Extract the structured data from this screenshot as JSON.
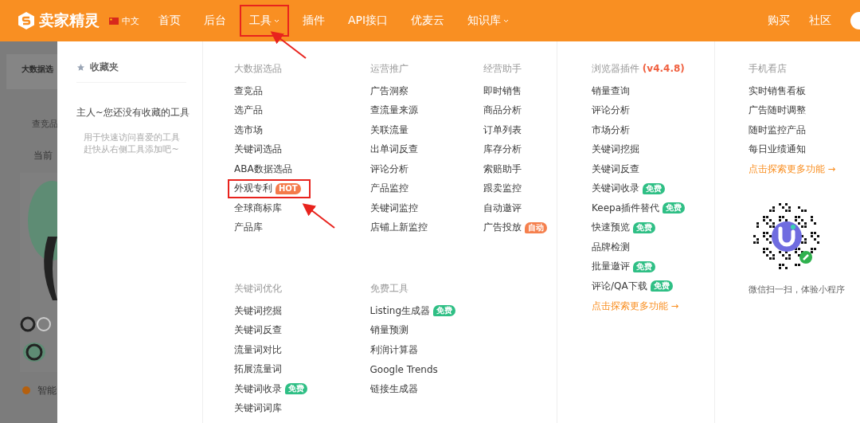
{
  "header": {
    "logo": "卖家精灵",
    "language": "中文",
    "nav": [
      {
        "label": "首页",
        "dropdown": false
      },
      {
        "label": "后台",
        "dropdown": false
      },
      {
        "label": "工具",
        "dropdown": true,
        "annotated": true
      },
      {
        "label": "插件",
        "dropdown": false
      },
      {
        "label": "API接口",
        "dropdown": false
      },
      {
        "label": "优麦云",
        "dropdown": false
      },
      {
        "label": "知识库",
        "dropdown": true
      }
    ],
    "right": [
      "购买",
      "社区"
    ]
  },
  "background_page": {
    "title": "大数据选",
    "tab": "查竞品",
    "note": "当前",
    "bottom": "智能"
  },
  "favorites": {
    "title": "收藏夹",
    "empty_title": "主人~您还没有收藏的工具",
    "empty_hint": [
      "用于快速访问喜爱的工具",
      "赶快从右侧工具添加吧~"
    ]
  },
  "groups": [
    {
      "columns": [
        {
          "sections": [
            {
              "title": "大数据选品",
              "items": [
                {
                  "label": "查竞品"
                },
                {
                  "label": "选产品"
                },
                {
                  "label": "选市场"
                },
                {
                  "label": "关键词选品"
                },
                {
                  "label": "ABA数据选品"
                },
                {
                  "label": "外观专利",
                  "badge": {
                    "kind": "hot",
                    "text": "HOT"
                  },
                  "annotated": true
                },
                {
                  "label": "全球商标库"
                },
                {
                  "label": "产品库"
                }
              ]
            },
            {
              "title": "关键词优化",
              "items": [
                {
                  "label": "关键词挖掘"
                },
                {
                  "label": "关键词反查"
                },
                {
                  "label": "流量词对比"
                },
                {
                  "label": "拓展流量词"
                },
                {
                  "label": "关键词收录",
                  "badge": {
                    "kind": "free",
                    "text": "免费"
                  }
                },
                {
                  "label": "关键词词库"
                }
              ]
            }
          ]
        },
        {
          "sections": [
            {
              "title": "运营推广",
              "items": [
                {
                  "label": "广告洞察"
                },
                {
                  "label": "查流量来源"
                },
                {
                  "label": "关联流量"
                },
                {
                  "label": "出单词反查"
                },
                {
                  "label": "评论分析"
                },
                {
                  "label": "产品监控"
                },
                {
                  "label": "关键词监控"
                },
                {
                  "label": "店铺上新监控"
                }
              ]
            },
            {
              "title": "免费工具",
              "items": [
                {
                  "label": "Listing生成器",
                  "badge": {
                    "kind": "free",
                    "text": "免费"
                  }
                },
                {
                  "label": "销量预测"
                },
                {
                  "label": "利润计算器"
                },
                {
                  "label": "Google Trends"
                },
                {
                  "label": "链接生成器"
                }
              ]
            }
          ]
        },
        {
          "sections": [
            {
              "title": "经营助手",
              "items": [
                {
                  "label": "即时销售"
                },
                {
                  "label": "商品分析"
                },
                {
                  "label": "订单列表"
                },
                {
                  "label": "库存分析"
                },
                {
                  "label": "索赔助手"
                },
                {
                  "label": "跟卖监控"
                },
                {
                  "label": "自动邀评"
                },
                {
                  "label": "广告投放",
                  "badge": {
                    "kind": "auto",
                    "text": "自动"
                  }
                }
              ]
            }
          ]
        }
      ]
    },
    {
      "columns": [
        {
          "sections": [
            {
              "title": "浏览器插件",
              "version": "(v4.4.8)",
              "items": [
                {
                  "label": "销量查询"
                },
                {
                  "label": "评论分析"
                },
                {
                  "label": "市场分析"
                },
                {
                  "label": "关键词挖掘"
                },
                {
                  "label": "关键词反查"
                },
                {
                  "label": "关键词收录",
                  "badge": {
                    "kind": "free",
                    "text": "免费"
                  }
                },
                {
                  "label": "Keepa插件替代",
                  "badge": {
                    "kind": "free",
                    "text": "免费"
                  }
                },
                {
                  "label": "快速预览",
                  "badge": {
                    "kind": "free",
                    "text": "免费"
                  }
                },
                {
                  "label": "品牌检测"
                },
                {
                  "label": "批量邀评",
                  "badge": {
                    "kind": "free",
                    "text": "免费"
                  }
                },
                {
                  "label": "评论/QA下载",
                  "badge": {
                    "kind": "free",
                    "text": "免费"
                  }
                }
              ],
              "more": "点击探索更多功能 →"
            }
          ]
        }
      ]
    },
    {
      "columns": [
        {
          "sections": [
            {
              "title": "手机看店",
              "items": [
                {
                  "label": "实时销售看板"
                },
                {
                  "label": "广告随时调整"
                },
                {
                  "label": "随时监控产品"
                },
                {
                  "label": "每日业绩通知"
                }
              ],
              "more": "点击探索更多功能 →",
              "qr_caption": "微信扫一扫，体验小程序"
            }
          ]
        }
      ]
    }
  ]
}
